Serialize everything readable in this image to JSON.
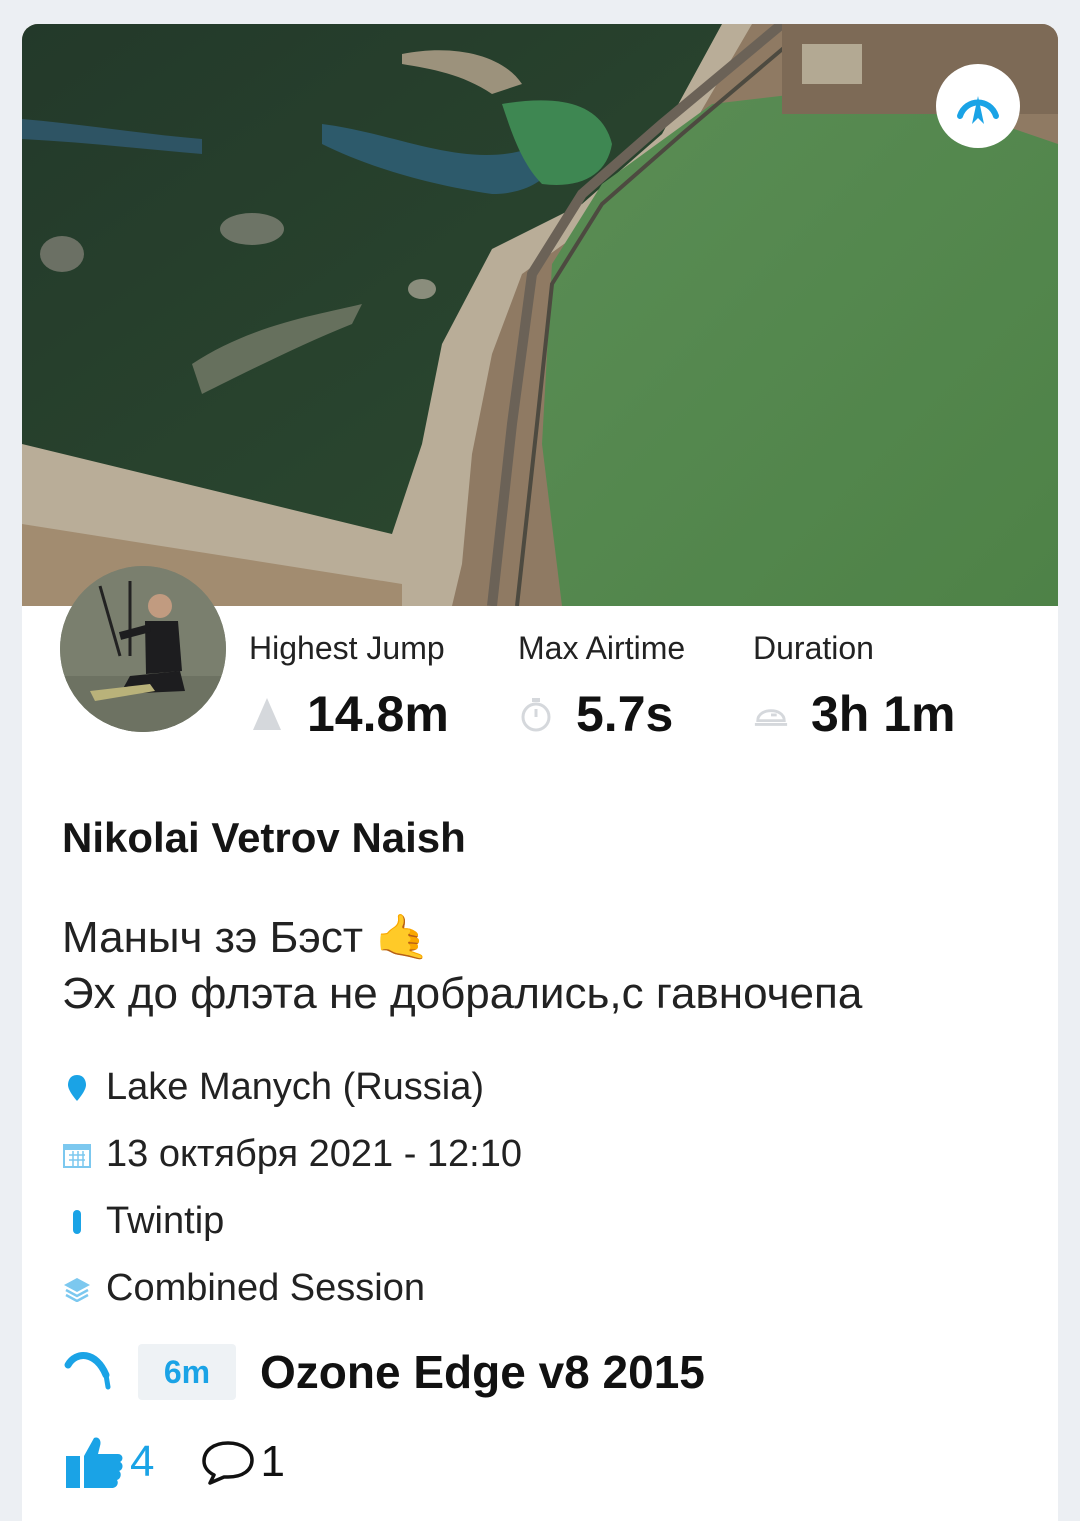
{
  "header": {
    "map_label": "satellite-map-preview"
  },
  "stats": [
    {
      "label": "Highest Jump",
      "value": "14.8m",
      "icon": "mountain-icon"
    },
    {
      "label": "Max Airtime",
      "value": "5.7s",
      "icon": "stopwatch-icon"
    },
    {
      "label": "Duration",
      "value": "3h 1m",
      "icon": "clock-icon"
    }
  ],
  "rider": {
    "name": "Nikolai Vetrov Naish"
  },
  "description": {
    "line1": "Маныч зэ Бэст",
    "line1_emoji": "🤙",
    "line2": "Эх до флэта не добрались,с гавночепа"
  },
  "meta": {
    "location": "Lake Manych (Russia)",
    "date": "13 октября 2021 - 12:10",
    "board": "Twintip",
    "session_type": "Combined Session"
  },
  "gear": {
    "kite_size": "6m",
    "kite_name": "Ozone Edge v8 2015"
  },
  "social": {
    "likes": "4",
    "comments": "1"
  },
  "colors": {
    "accent": "#1aa3e6",
    "text": "#111111",
    "background": "#ffffff"
  }
}
